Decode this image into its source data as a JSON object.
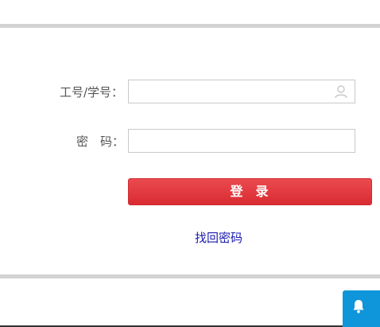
{
  "login": {
    "username_label": "工号/学号：",
    "password_label_chars": [
      "密",
      "码："
    ],
    "username_value": "",
    "password_value": "",
    "login_button_chars": [
      "登",
      "录"
    ],
    "forgot_password": "找回密码"
  },
  "icons": {
    "username_field": "user-icon",
    "float_button": "bell-icon"
  },
  "colors": {
    "primary_button": "#e23a40",
    "link": "#1a1ab0",
    "float_button": "#0f95d9",
    "divider": "#d3d3d3"
  }
}
